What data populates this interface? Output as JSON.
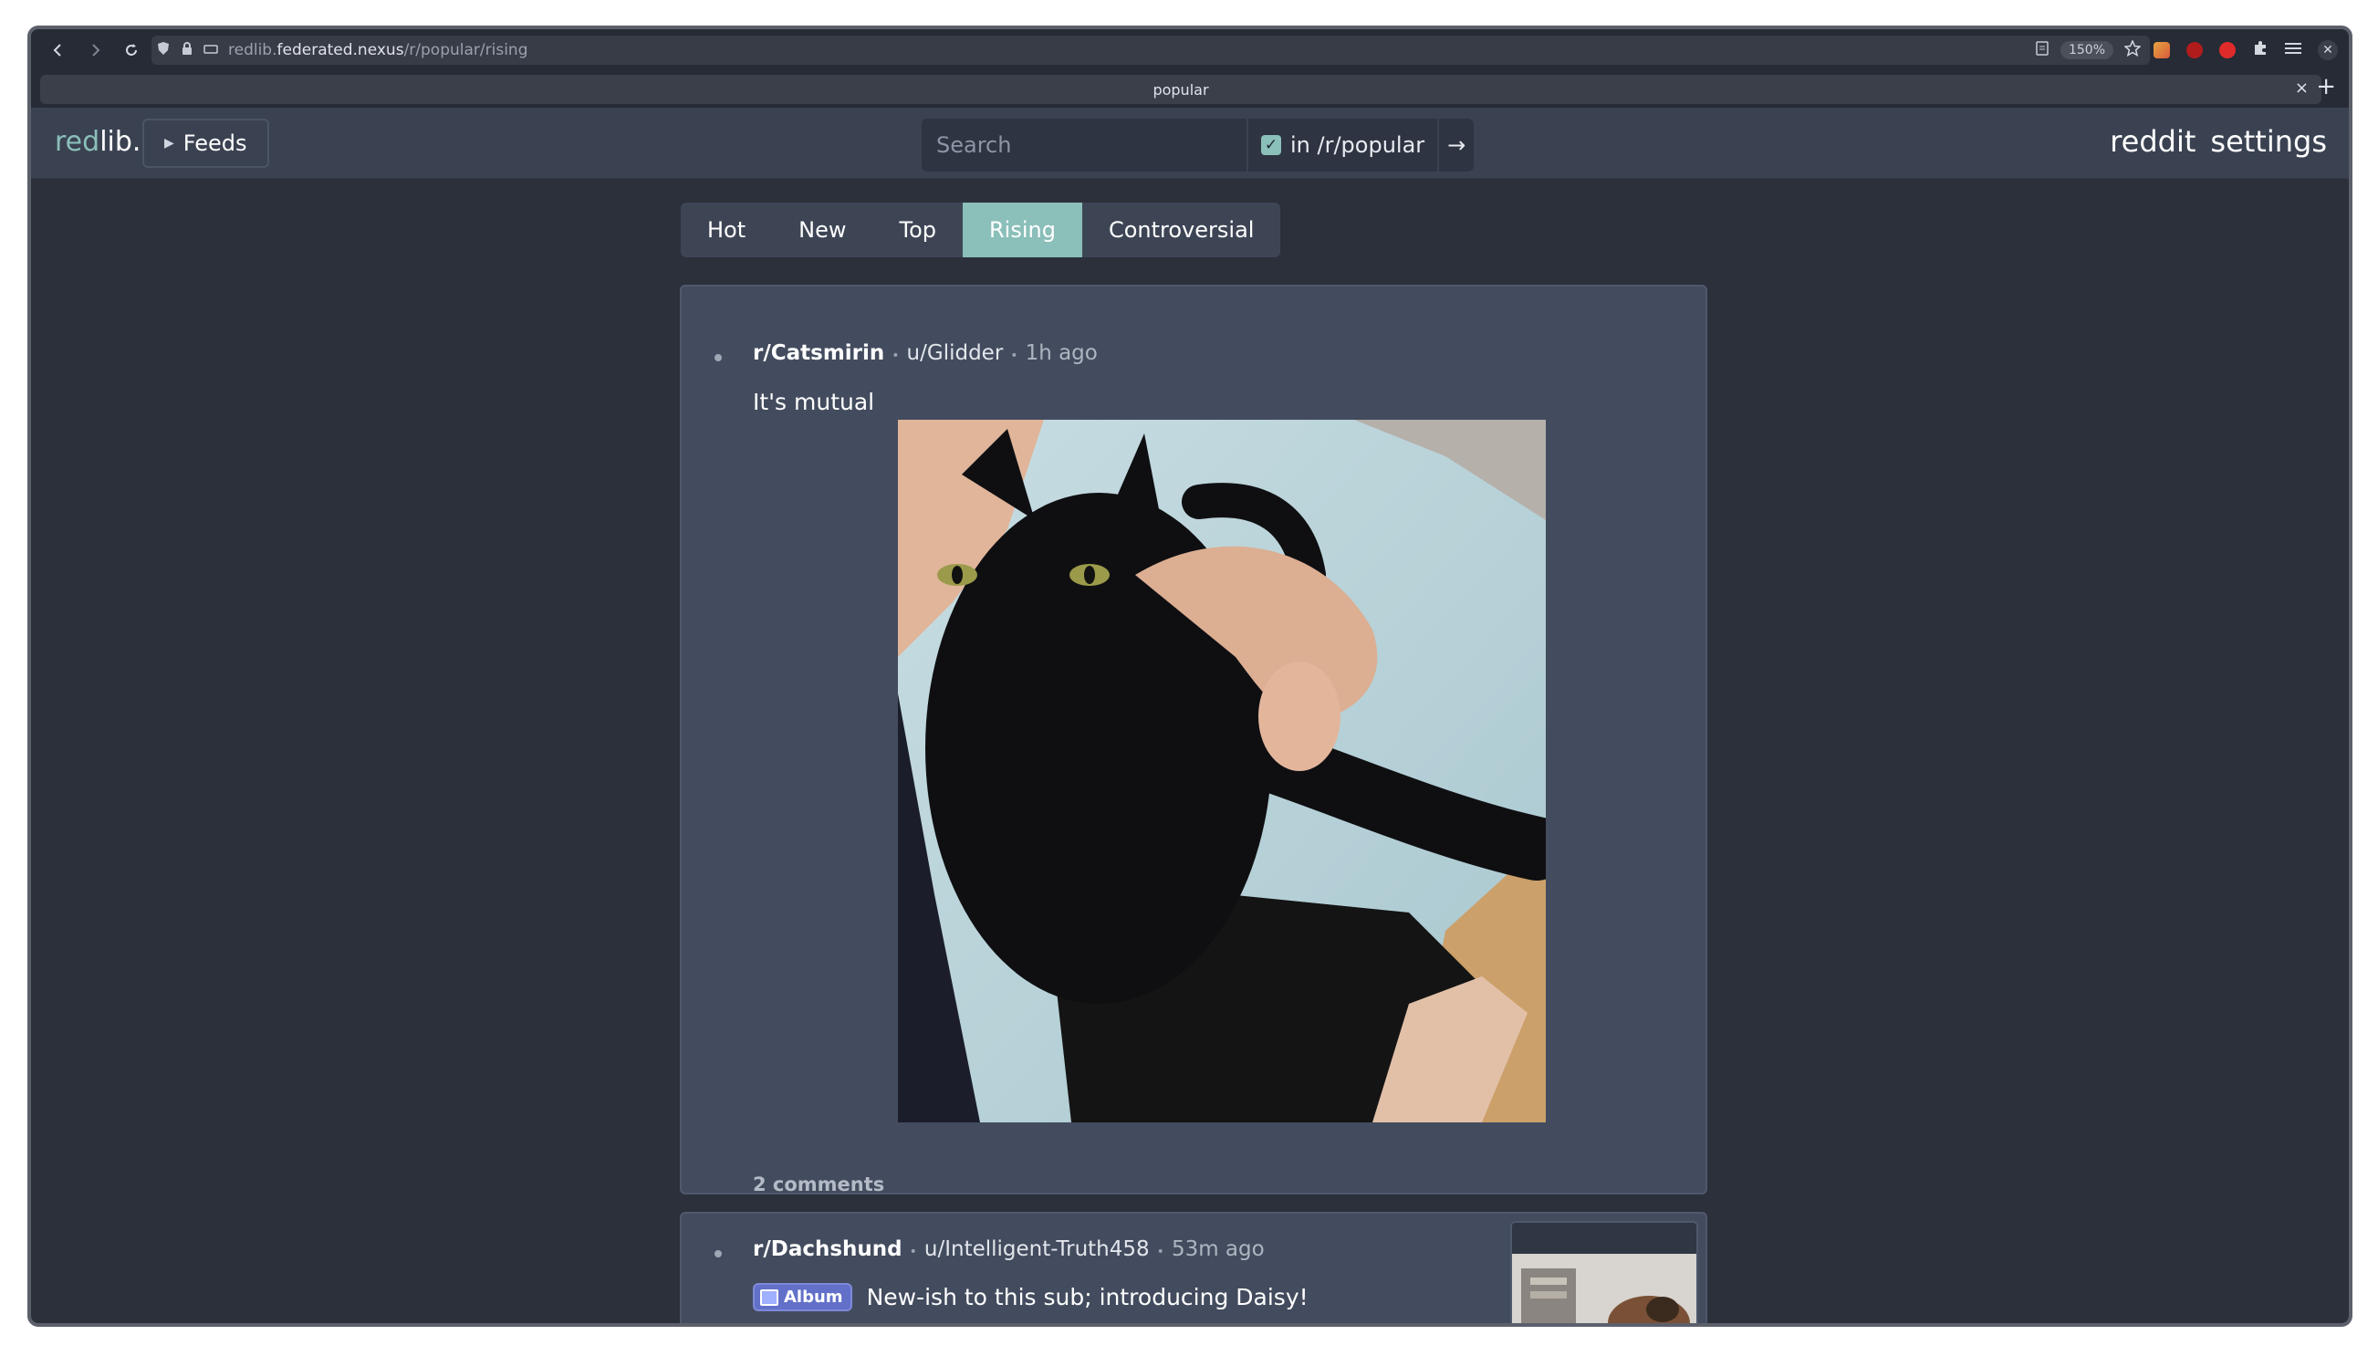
{
  "browser": {
    "url_prefix": "redlib.",
    "url_domain": "federated.nexus",
    "url_path": "/r/popular/rising",
    "zoom": "150%",
    "tab_title": "popular",
    "tab_close": "×",
    "new_tab": "+"
  },
  "nav": {
    "logo_red": "red",
    "logo_lib": "lib.",
    "feeds_label": "Feeds",
    "search_placeholder": "Search",
    "restrict_label": "in /r/popular",
    "restrict_checked": true,
    "go_label": "→",
    "reddit_label": "reddit",
    "settings_label": "settings"
  },
  "sort_tabs": [
    {
      "label": "Hot",
      "active": false
    },
    {
      "label": "New",
      "active": false
    },
    {
      "label": "Top",
      "active": false
    },
    {
      "label": "Rising",
      "active": true
    },
    {
      "label": "Controversial",
      "active": false
    }
  ],
  "posts": [
    {
      "subreddit": "r/Catsmirin",
      "user": "u/Glidder",
      "time": "1h ago",
      "title": "It's mutual",
      "comments": "2 comments",
      "media": "black cat lying on a lap being petted by a hand, light blue bedsheet in background"
    },
    {
      "subreddit": "r/Dachshund",
      "user": "u/Intelligent-Truth458",
      "time": "53m ago",
      "flair": "Album",
      "title": "New-ish to this sub; introducing Daisy!"
    }
  ],
  "colors": {
    "accent": "#8bbfb9",
    "page_bg": "#2b303b",
    "post_bg": "#434c5e",
    "nav_bg": "#3a4252",
    "flair_bg": "#6270c9"
  }
}
